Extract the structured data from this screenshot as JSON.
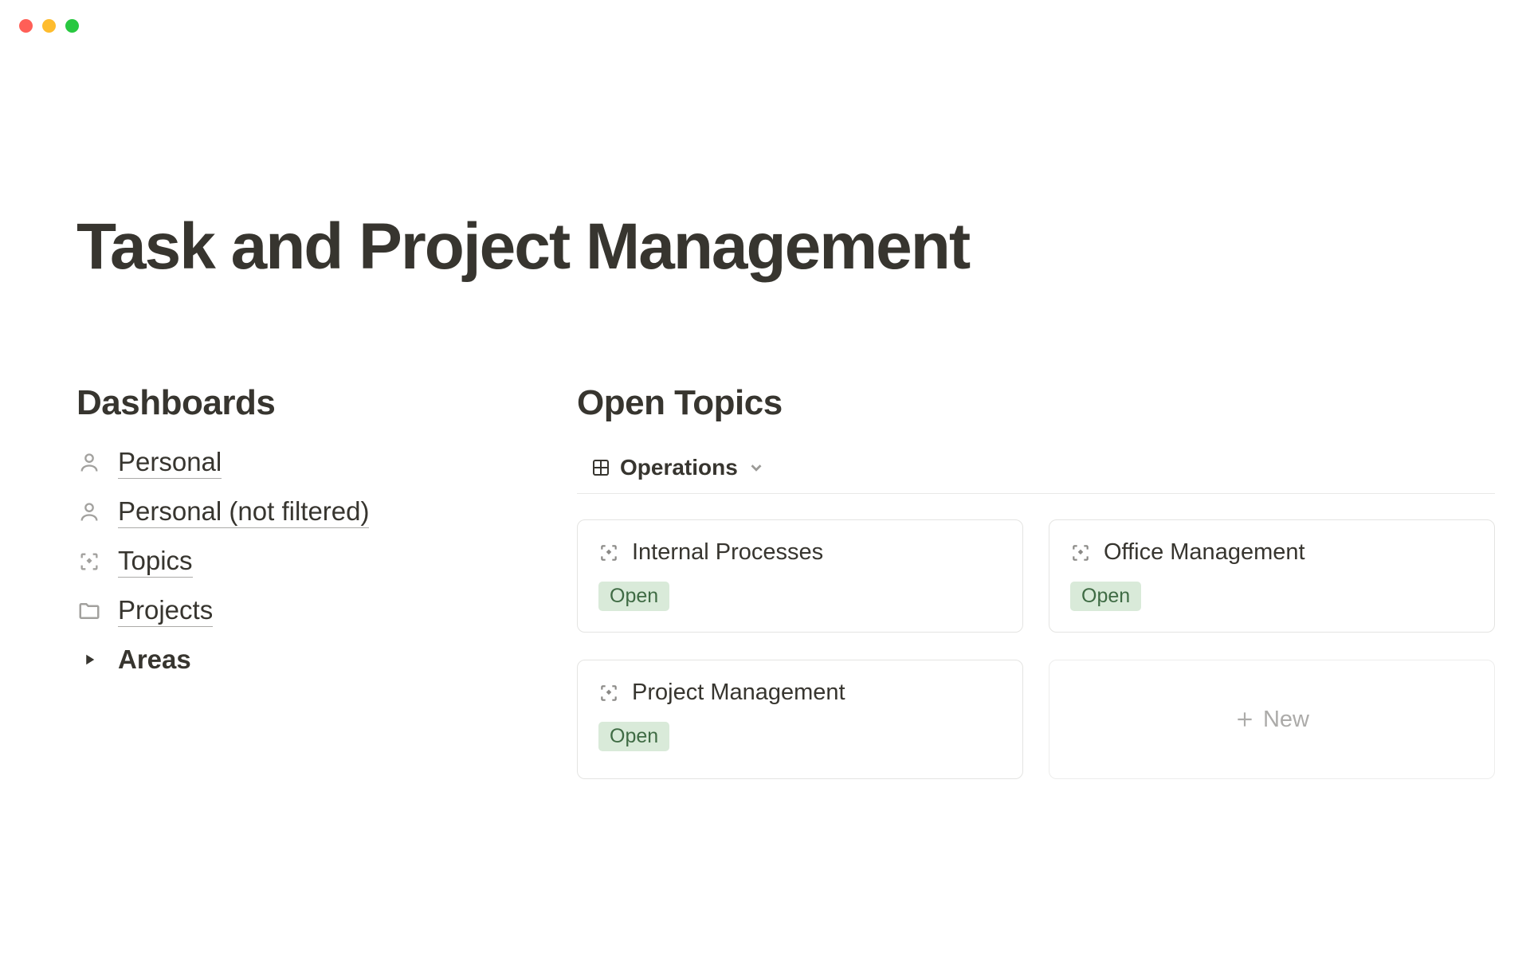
{
  "page": {
    "title": "Task and Project Management"
  },
  "sections": {
    "dashboards_heading": "Dashboards",
    "open_topics_heading": "Open Topics"
  },
  "dashboards": [
    {
      "label": "Personal",
      "icon": "person",
      "underlined": true
    },
    {
      "label": "Personal (not filtered)",
      "icon": "person",
      "underlined": true
    },
    {
      "label": "Topics",
      "icon": "focus",
      "underlined": true
    },
    {
      "label": "Projects",
      "icon": "folder",
      "underlined": true
    },
    {
      "label": "Areas",
      "icon": "triangle",
      "underlined": false,
      "bold": true
    }
  ],
  "view": {
    "selected": "Operations"
  },
  "topics": [
    {
      "title": "Internal Processes",
      "status": "Open"
    },
    {
      "title": "Office Management",
      "status": "Open"
    },
    {
      "title": "Project Management",
      "status": "Open"
    }
  ],
  "new_card_label": "New",
  "colors": {
    "status_open_bg": "#d9ead9",
    "status_open_fg": "#3f6b44"
  }
}
